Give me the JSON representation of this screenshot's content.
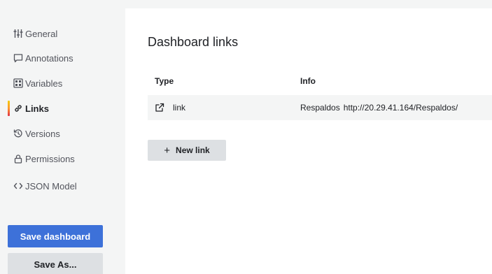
{
  "sidebar": {
    "items": [
      {
        "label": "General",
        "icon": "sliders-icon",
        "active": false
      },
      {
        "label": "Annotations",
        "icon": "comment-icon",
        "active": false
      },
      {
        "label": "Variables",
        "icon": "calculator-icon",
        "active": false
      },
      {
        "label": "Links",
        "icon": "link-icon",
        "active": true
      },
      {
        "label": "Versions",
        "icon": "history-icon",
        "active": false
      },
      {
        "label": "Permissions",
        "icon": "lock-icon",
        "active": false
      },
      {
        "label": "JSON Model",
        "icon": "code-icon",
        "active": false
      }
    ],
    "save_label": "Save dashboard",
    "save_as_label": "Save As..."
  },
  "main": {
    "title": "Dashboard links",
    "columns": {
      "type": "Type",
      "info": "Info"
    },
    "rows": [
      {
        "type": "link",
        "type_icon": "external-link-icon",
        "title": "Respaldos",
        "url": "http://20.29.41.164/Respaldos/"
      }
    ],
    "new_link_label": "New link"
  },
  "colors": {
    "primary_button": "#3d71d9",
    "secondary_button": "#dde0e3",
    "active_indicator": [
      "#f2cc0c",
      "#ff9830",
      "#e02f44"
    ]
  }
}
